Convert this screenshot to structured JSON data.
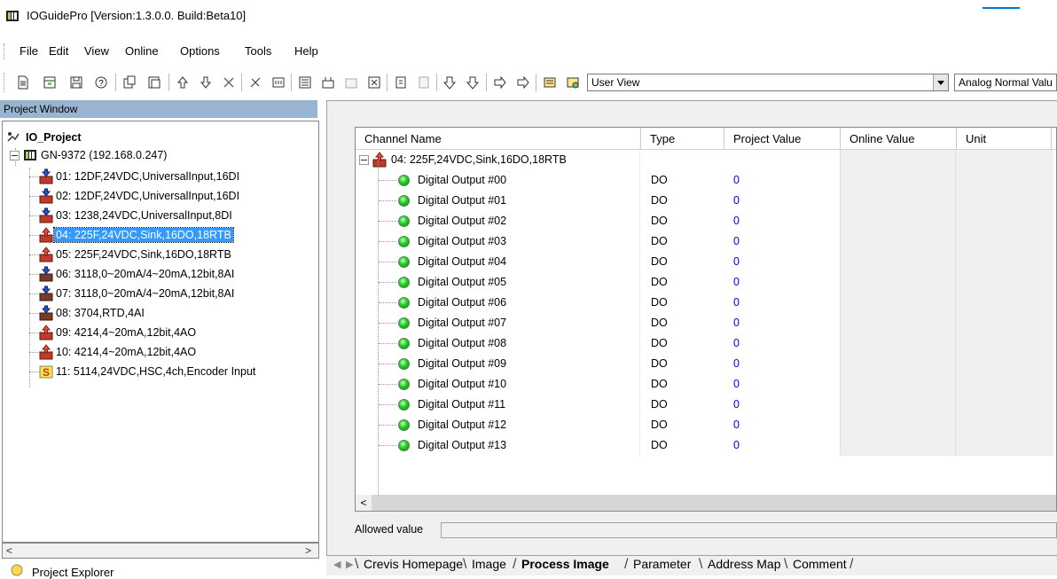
{
  "window": {
    "title": "IOGuidePro [Version:1.3.0.0. Build:Beta10]"
  },
  "menu": [
    "File",
    "Edit",
    "View",
    "Online",
    "Options",
    "Tools",
    "Help"
  ],
  "toolbar": {
    "view_combo": "User View",
    "analog_combo": "Analog Normal Valu"
  },
  "project_window": {
    "header": "Project Window",
    "root": "IO_Project",
    "adapter": "GN-9372 (192.168.0.247)",
    "modules": [
      "01: 12DF,24VDC,UniversalInput,16DI",
      "02: 12DF,24VDC,UniversalInput,16DI",
      "03: 1238,24VDC,UniversalInput,8DI",
      "04: 225F,24VDC,Sink,16DO,18RTB",
      "05: 225F,24VDC,Sink,16DO,18RTB",
      "06: 3118,0~20mA/4~20mA,12bit,8AI",
      "07: 3118,0~20mA/4~20mA,12bit,8AI",
      "08: 3704,RTD,4AI",
      "09: 4214,4~20mA,12bit,4AO",
      "10: 4214,4~20mA,12bit,4AO",
      "11: 5114,24VDC,HSC,4ch,Encoder Input"
    ],
    "selected_index": 3,
    "explorer_tab": "Project Explorer"
  },
  "grid": {
    "columns": [
      "Channel Name",
      "Type",
      "Project Value",
      "Online Value",
      "Unit"
    ],
    "group": "04: 225F,24VDC,Sink,16DO,18RTB",
    "rows": [
      {
        "name": "Digital Output #00",
        "type": "DO",
        "value": "0"
      },
      {
        "name": "Digital Output #01",
        "type": "DO",
        "value": "0"
      },
      {
        "name": "Digital Output #02",
        "type": "DO",
        "value": "0"
      },
      {
        "name": "Digital Output #03",
        "type": "DO",
        "value": "0"
      },
      {
        "name": "Digital Output #04",
        "type": "DO",
        "value": "0"
      },
      {
        "name": "Digital Output #05",
        "type": "DO",
        "value": "0"
      },
      {
        "name": "Digital Output #06",
        "type": "DO",
        "value": "0"
      },
      {
        "name": "Digital Output #07",
        "type": "DO",
        "value": "0"
      },
      {
        "name": "Digital Output #08",
        "type": "DO",
        "value": "0"
      },
      {
        "name": "Digital Output #09",
        "type": "DO",
        "value": "0"
      },
      {
        "name": "Digital Output #10",
        "type": "DO",
        "value": "0"
      },
      {
        "name": "Digital Output #11",
        "type": "DO",
        "value": "0"
      },
      {
        "name": "Digital Output #12",
        "type": "DO",
        "value": "0"
      },
      {
        "name": "Digital Output #13",
        "type": "DO",
        "value": "0"
      }
    ]
  },
  "allowed_value_label": "Allowed value",
  "tabs": [
    {
      "label": "Crevis Homepage",
      "active": false
    },
    {
      "label": "Image",
      "active": false
    },
    {
      "label": "Process Image",
      "active": true
    },
    {
      "label": "Parameter",
      "active": false
    },
    {
      "label": "Address Map",
      "active": false
    },
    {
      "label": "Comment",
      "active": false
    }
  ],
  "colors": {
    "selection": "#3399ff",
    "header_bar": "#99b4d1",
    "value_blue": "#0000ee"
  }
}
